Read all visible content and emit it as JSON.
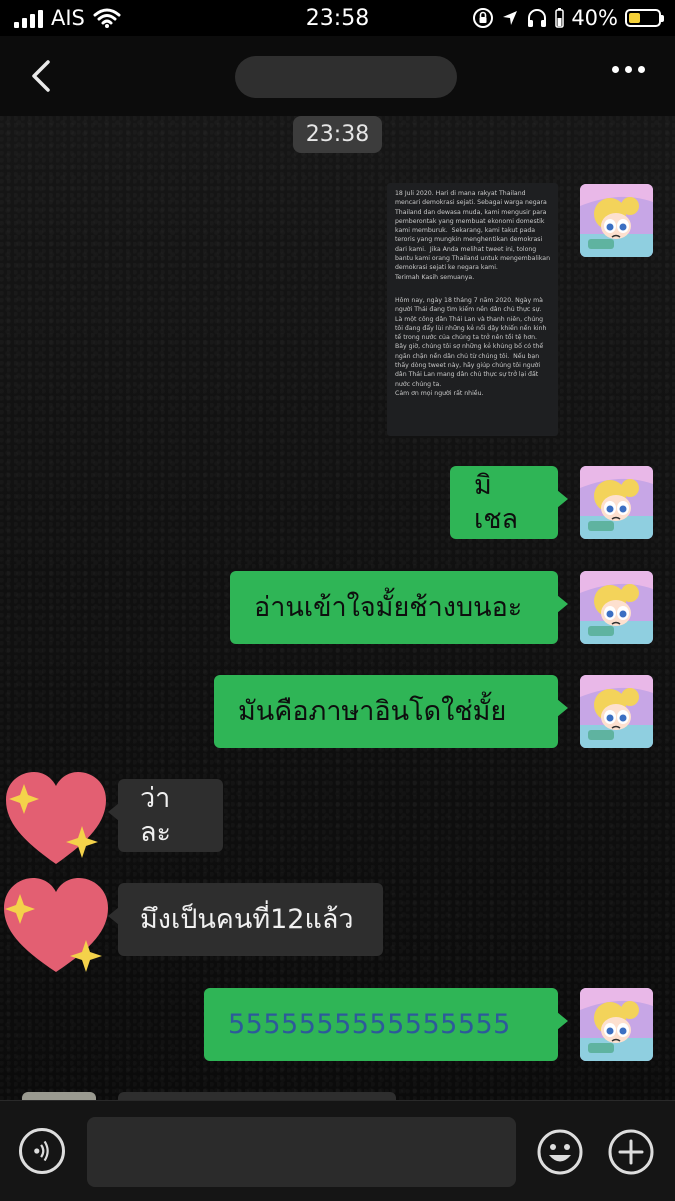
{
  "status_bar": {
    "carrier": "AIS",
    "time": "23:58",
    "battery": "40%",
    "battery_level": 0.4,
    "icons": [
      "signal-icon",
      "wifi-icon",
      "orientation-lock-icon",
      "location-icon",
      "headphones-icon",
      "battery-icon"
    ]
  },
  "nav": {
    "back_icon": "chevron-left-icon",
    "more_icon": "more-dots-icon"
  },
  "chat": {
    "timestamp": "23:38",
    "tweet_image": {
      "para_id": "18 Juli 2020. Hari di mana rakyat Thailand mencari demokrasi sejati. Sebagai warga negara Thailand dan dewasa muda, kami mengusir para pemberontak yang membuat ekonomi domestik kami memburuk.  Sekarang, kami takut pada teroris yang mungkin menghentikan demokrasi dari kami.  Jika Anda melihat tweet ini, tolong bantu kami orang Thailand untuk mengembalikan demokrasi sejati ke negara kami.\nTerimah Kasih semuanya.",
      "para_vi": "Hôm nay, ngày 18 tháng 7 năm 2020. Ngày mà người Thái đang tìm kiếm nền dân chủ thực sự.  Là một công dân Thái Lan và thanh niên, chúng tôi đang đẩy lùi những kẻ nổi dậy khiến nền kinh tế trong nước của chúng ta trở nên tồi tệ hơn.  Bây giờ, chúng tôi sợ những kẻ khủng bố có thể ngăn chặn nền dân chủ từ chúng tôi.  Nếu bạn thấy dòng tweet này, hãy giúp chúng tôi người dân Thái Lan mang dân chủ thực sự trở lại đất nước chúng ta.\nCảm ơn mọi người rất nhiều."
    },
    "messages": [
      {
        "side": "me",
        "text": "มิเชล"
      },
      {
        "side": "me",
        "text": "อ่านเข้าใจมั้ยช้างบนอะ"
      },
      {
        "side": "me",
        "text": "มันคือภาษาอินโดใช่มั้ย"
      },
      {
        "side": "them",
        "text": "ว่าละ"
      },
      {
        "side": "them",
        "text": "มึงเป็นคนที่12แล้ว"
      },
      {
        "side": "me",
        "text": "5555555555555555"
      }
    ]
  },
  "input_bar": {
    "voice_icon": "voice-icon",
    "emoji_icon": "emoji-icon",
    "plus_icon": "plus-icon"
  },
  "colors": {
    "my_bubble": "#2fb556",
    "their_bubble": "#2e2e2e",
    "background": "#000000",
    "battery_fill": "#f4d038"
  }
}
